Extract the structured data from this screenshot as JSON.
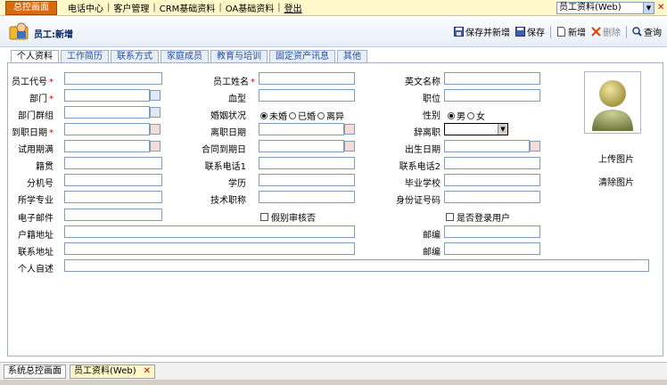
{
  "topbar": {
    "home": "总控画面",
    "nav": [
      "电话中心",
      "客户管理",
      "CRM基础资料",
      "OA基础资料",
      "登出"
    ],
    "window_select": "员工资料(Web)"
  },
  "header": {
    "title": "员工:新增",
    "save_new": "保存并新增",
    "save": "保存",
    "new": "新增",
    "delete": "删除",
    "query": "查询"
  },
  "tabs": [
    "个人资料",
    "工作简历",
    "联系方式",
    "家庭成员",
    "教育与培训",
    "固定资产讯息",
    "其他"
  ],
  "form": {
    "emp_code": "员工代号",
    "emp_name": "员工姓名",
    "eng_name": "英文名称",
    "dept": "部门",
    "blood": "血型",
    "position": "职位",
    "dept_group": "部门群组",
    "marital": "婚姻状况",
    "marital_opts": [
      "未婚",
      "已婚",
      "离异"
    ],
    "gender": "性别",
    "gender_opts": [
      "男",
      "女"
    ],
    "join_date": "到职日期",
    "leave_date": "离职日期",
    "leave_flag": "辞离职",
    "probation": "试用期满",
    "contract_end": "合同到期日",
    "birth": "出生日期",
    "hometown": "籍贯",
    "phone1": "联系电话1",
    "phone2": "联系电话2",
    "ext": "分机号",
    "education": "学历",
    "school": "毕业学校",
    "major": "所学专业",
    "title": "技术职称",
    "id_no": "身份证号码",
    "email": "电子邮件",
    "leave_approve": "假别审核否",
    "login_user": "是否登录用户",
    "reg_addr": "户籍地址",
    "zip1": "邮编",
    "addr": "联系地址",
    "zip2": "邮编",
    "resume": "个人自述",
    "upload": "上传图片",
    "clear": "清除图片"
  },
  "bottom_tabs": [
    "系统总控画面",
    "员工资料(Web)"
  ]
}
